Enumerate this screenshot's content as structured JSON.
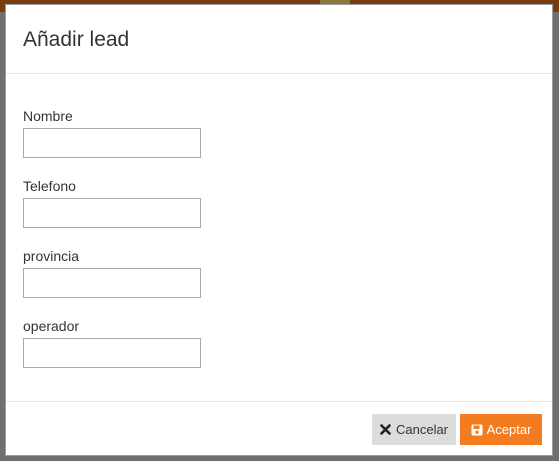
{
  "modal": {
    "title": "Añadir lead",
    "fields": [
      {
        "label": "Nombre",
        "value": "",
        "placeholder": ""
      },
      {
        "label": "Telefono",
        "value": "",
        "placeholder": ""
      },
      {
        "label": "provincia",
        "value": "",
        "placeholder": ""
      },
      {
        "label": "operador",
        "value": "",
        "placeholder": ""
      }
    ],
    "buttons": {
      "cancel_label": "Cancelar",
      "cancel_icon": "close-icon",
      "accept_label": "Aceptar",
      "accept_icon": "save-icon"
    }
  },
  "colors": {
    "accent": "#f47c20",
    "cancel_bg": "#dcdcdc",
    "backdrop": "#6f6f6f"
  }
}
